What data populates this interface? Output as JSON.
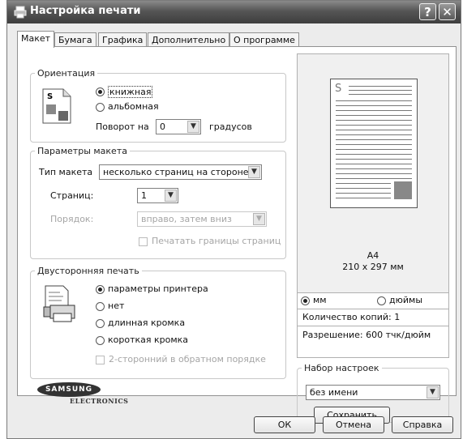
{
  "window": {
    "title": "Настройка печати",
    "help_button": "?",
    "close_button": "✕"
  },
  "tabs": [
    {
      "label": "Макет"
    },
    {
      "label": "Бумага"
    },
    {
      "label": "Графика"
    },
    {
      "label": "Дополнительно"
    },
    {
      "label": "О программе"
    }
  ],
  "orientation": {
    "group_label": "Ориентация",
    "portrait_label": "книжная",
    "landscape_label": "альбомная",
    "selected": "книжная",
    "rotate_label": "Поворот на",
    "rotate_value": "0",
    "rotate_unit": "градусов",
    "icon_letter": "S"
  },
  "layout": {
    "group_label": "Параметры макета",
    "type_label": "Тип макета",
    "type_value": "несколько страниц на стороне",
    "pages_label": "Страниц:",
    "pages_value": "1",
    "order_label": "Порядок:",
    "order_value": "вправо, затем вниз",
    "borders_label": "Печатать границы страниц"
  },
  "duplex": {
    "group_label": "Двусторонняя печать",
    "options": [
      "параметры принтера",
      "нет",
      "длинная кромка",
      "короткая кромка"
    ],
    "selected": "параметры принтера",
    "reverse_label": "2-сторонний в обратном порядке"
  },
  "logo": {
    "brand": "SAMSUNG",
    "sub": "ELECTRONICS"
  },
  "preview": {
    "page_letter": "S",
    "paper_name": "A4",
    "paper_size": "210 x 297 мм",
    "unit_mm": "мм",
    "unit_inch": "дюймы",
    "selected_unit": "мм",
    "copies": "Количество копий: 1",
    "resolution": "Разрешение: 600 тчк/дюйм"
  },
  "presets": {
    "group_label": "Набор настроек",
    "value": "без имени",
    "save_label": "Сохранить"
  },
  "footer": {
    "ok_label": "ОК",
    "cancel_label": "Отмена",
    "help_label": "Справка"
  }
}
